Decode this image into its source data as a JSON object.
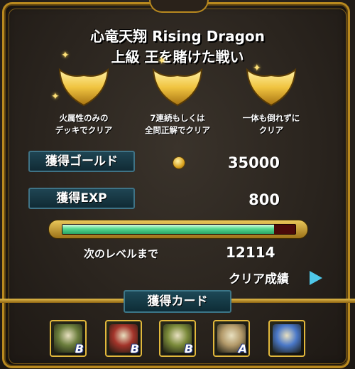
{
  "title": {
    "line1": "心竜天翔 Rising Dragon",
    "line2": "上級 王を賭けた戦い"
  },
  "badges": [
    {
      "icon": "gold-crest-badge-icon",
      "line1": "火属性のみの",
      "line2": "デッキでクリア"
    },
    {
      "icon": "gold-crest-badge-icon",
      "line1": "7連続もしくは",
      "line2": "全問正解でクリア"
    },
    {
      "icon": "gold-crest-badge-icon",
      "line1": "一体も倒れずに",
      "line2": "クリア"
    }
  ],
  "stats": {
    "gold_label": "獲得ゴールド",
    "gold_value": "35000",
    "exp_label": "獲得EXP",
    "exp_value": "800",
    "exp_progress": 0.91,
    "next_level_label": "次のレベルまで",
    "next_level_value": "12114"
  },
  "clear_record": {
    "label": "クリア成績",
    "arrow_icon": "play-arrow-icon"
  },
  "cards": {
    "header": "獲得カード",
    "items": [
      {
        "icon": "dragon-card-icon",
        "rank": "B",
        "color": "#6a7d3c"
      },
      {
        "icon": "dragon-card-icon",
        "rank": "B",
        "color": "#a3342a"
      },
      {
        "icon": "dragon-card-icon",
        "rank": "B",
        "color": "#7a8a3a"
      },
      {
        "icon": "skull-card-icon",
        "rank": "A",
        "color": "#b39a6a"
      },
      {
        "icon": "treasure-card-icon",
        "rank": "",
        "color": "#4a78c8"
      }
    ]
  },
  "colors": {
    "frame_gold": "#b8891f",
    "label_teal": "#1f4553",
    "exp_fill": "#55d891",
    "arrow_blue": "#4fc7e8"
  }
}
